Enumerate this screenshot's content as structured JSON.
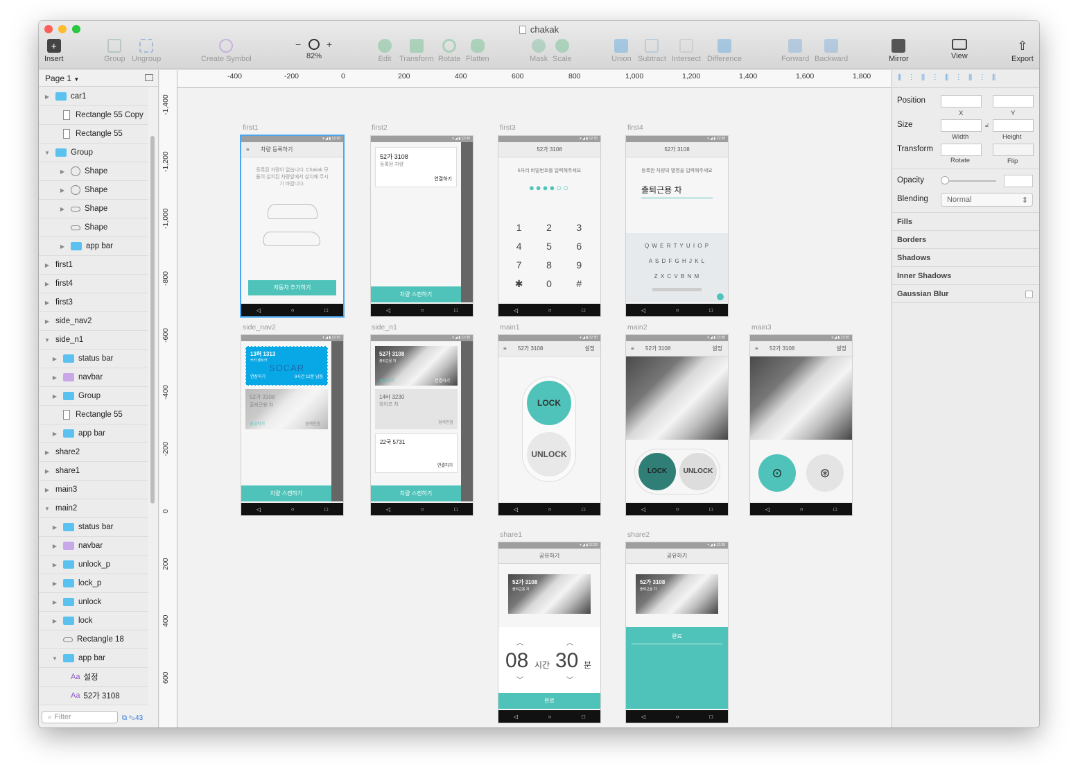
{
  "window": {
    "title": "chakak"
  },
  "toolbar": {
    "insert": "Insert",
    "group": "Group",
    "ungroup": "Ungroup",
    "create_symbol": "Create Symbol",
    "zoom_minus": "−",
    "zoom_plus": "+",
    "zoom": "82%",
    "edit": "Edit",
    "transform": "Transform",
    "rotate": "Rotate",
    "flatten": "Flatten",
    "mask": "Mask",
    "scale": "Scale",
    "union": "Union",
    "subtract": "Subtract",
    "intersect": "Intersect",
    "difference": "Difference",
    "forward": "Forward",
    "backward": "Backward",
    "mirror": "Mirror",
    "view": "View",
    "export": "Export"
  },
  "layers": {
    "page": "Page 1",
    "items": [
      {
        "label": "car1",
        "icon": "folder",
        "depth": 0,
        "tri": "▶"
      },
      {
        "label": "Rectangle 55 Copy",
        "icon": "rect",
        "depth": 1,
        "tri": ""
      },
      {
        "label": "Rectangle 55",
        "icon": "rect",
        "depth": 1,
        "tri": ""
      },
      {
        "label": "Group",
        "icon": "folder",
        "depth": 0,
        "tri": "▼"
      },
      {
        "label": "Shape",
        "icon": "oval",
        "depth": 2,
        "tri": "▶"
      },
      {
        "label": "Shape",
        "icon": "oval",
        "depth": 2,
        "tri": "▶"
      },
      {
        "label": "Shape",
        "icon": "pill",
        "depth": 2,
        "tri": "▶"
      },
      {
        "label": "Shape",
        "icon": "pill",
        "depth": 2,
        "tri": ""
      },
      {
        "label": "app bar",
        "icon": "folder",
        "depth": 2,
        "tri": "▶"
      },
      {
        "label": "first1",
        "icon": "",
        "depth": 0,
        "tri": "▶"
      },
      {
        "label": "first4",
        "icon": "",
        "depth": 0,
        "tri": "▶"
      },
      {
        "label": "first3",
        "icon": "",
        "depth": 0,
        "tri": "▶"
      },
      {
        "label": "side_nav2",
        "icon": "",
        "depth": 0,
        "tri": "▶"
      },
      {
        "label": "side_n1",
        "icon": "",
        "depth": 0,
        "tri": "▼"
      },
      {
        "label": "status bar",
        "icon": "folder",
        "depth": 1,
        "tri": "▶"
      },
      {
        "label": "navbar",
        "icon": "folderp",
        "depth": 1,
        "tri": "▶"
      },
      {
        "label": "Group",
        "icon": "folder",
        "depth": 1,
        "tri": "▶"
      },
      {
        "label": "Rectangle 55",
        "icon": "rect",
        "depth": 1,
        "tri": ""
      },
      {
        "label": "app bar",
        "icon": "folder",
        "depth": 1,
        "tri": "▶"
      },
      {
        "label": "share2",
        "icon": "",
        "depth": 0,
        "tri": "▶"
      },
      {
        "label": "share1",
        "icon": "",
        "depth": 0,
        "tri": "▶"
      },
      {
        "label": "main3",
        "icon": "",
        "depth": 0,
        "tri": "▶"
      },
      {
        "label": "main2",
        "icon": "",
        "depth": 0,
        "tri": "▼"
      },
      {
        "label": "status bar",
        "icon": "folder",
        "depth": 1,
        "tri": "▶"
      },
      {
        "label": "navbar",
        "icon": "folderp",
        "depth": 1,
        "tri": "▶"
      },
      {
        "label": "unlock_p",
        "icon": "folder",
        "depth": 1,
        "tri": "▶"
      },
      {
        "label": "lock_p",
        "icon": "folder",
        "depth": 1,
        "tri": "▶"
      },
      {
        "label": "unlock",
        "icon": "folder",
        "depth": 1,
        "tri": "▶"
      },
      {
        "label": "lock",
        "icon": "folder",
        "depth": 1,
        "tri": "▶"
      },
      {
        "label": "Rectangle 18",
        "icon": "pill",
        "depth": 1,
        "tri": ""
      },
      {
        "label": "app bar",
        "icon": "folder",
        "depth": 1,
        "tri": "▼"
      },
      {
        "label": "설정",
        "icon": "text",
        "depth": 2,
        "tri": ""
      },
      {
        "label": "52가 3108",
        "icon": "text",
        "depth": 2,
        "tri": ""
      }
    ],
    "filter_placeholder": "Filter",
    "count": "43"
  },
  "rulers": {
    "h": [
      "-400",
      "-200",
      "0",
      "200",
      "400",
      "600",
      "800",
      "1,000",
      "1,200",
      "1,400",
      "1,600",
      "1,800"
    ],
    "v": [
      "-1,400",
      "-1,200",
      "-1,000",
      "-800",
      "-600",
      "-400",
      "-200",
      "0",
      "200",
      "400",
      "600",
      "800"
    ]
  },
  "artboards": {
    "first1": {
      "name": "first1",
      "title": "차량 등록하기",
      "body": "등록된 차량이 없습니다. Chakak 모듈이 설치된 차량앞에서 설치해 주시기 바랍니다.",
      "button": "자동차 추가하기"
    },
    "first2": {
      "name": "first2",
      "car": "52가 3108",
      "sub": "등록된 차량",
      "connect": "연결하기",
      "button": "차량 스캔하기"
    },
    "first3": {
      "name": "first3",
      "title": "52가 3108",
      "prompt": "6자리 비밀번호를 입력해주세요",
      "keys": [
        "1",
        "2",
        "3",
        "4",
        "5",
        "6",
        "7",
        "8",
        "9",
        "✱",
        "0",
        "#"
      ]
    },
    "first4": {
      "name": "first4",
      "title": "52가 3108",
      "prompt": "등록한 차량의 별명을 입력해주세요",
      "value": "출퇴근용 차",
      "row1": "Q W E R T Y U I O P",
      "row2": "A S D F G H J K L",
      "row3": "Z X C V B N M"
    },
    "side_nav2": {
      "name": "side_nav2",
      "card": "13허 1313",
      "card_sub": "쏘카 렌트카",
      "brand": "SOCAR",
      "left": "연장하기",
      "right": "9시간 12분 남음",
      "car2": "52가 3108",
      "car2_sub": "출퇴근용 차",
      "share": "공유하기",
      "owner": "경색인함",
      "button": "차량 스캔하기"
    },
    "side_n1": {
      "name": "side_n1",
      "car1": "52가 3108",
      "car1_sub": "출퇴근용 차",
      "share": "공유하기",
      "connect": "연결하기",
      "car2": "14바 3230",
      "car2_sub": "와이프 차",
      "owner": "경색인함",
      "car3": "22국 5731",
      "connect2": "연결하기",
      "button": "차량 스캔하기"
    },
    "main1": {
      "name": "main1",
      "title": "52가 3108",
      "settings": "설정",
      "lock": "LOCK",
      "unlock": "UNLOCK"
    },
    "main2": {
      "name": "main2",
      "title": "52가 3108",
      "settings": "설정",
      "lock": "LOCK",
      "unlock": "UNLOCK"
    },
    "main3": {
      "name": "main3",
      "title": "52가 3108",
      "settings": "설정"
    },
    "share1": {
      "name": "share1",
      "title": "공유하기",
      "car": "52가 3108",
      "car_sub": "출퇴근용 차",
      "hours": "08",
      "hours_unit": "시간",
      "minutes": "30",
      "minutes_unit": "분",
      "button": "완료"
    },
    "share2": {
      "name": "share2",
      "title": "공유하기",
      "car": "52가 3108",
      "car_sub": "출퇴근용 차",
      "button": "완료"
    }
  },
  "inspector": {
    "position": "Position",
    "x": "X",
    "y": "Y",
    "size": "Size",
    "width": "Width",
    "height": "Height",
    "transform": "Transform",
    "rotate": "Rotate",
    "flip": "Flip",
    "opacity": "Opacity",
    "blending": "Blending",
    "blending_value": "Normal",
    "sections": [
      "Fills",
      "Borders",
      "Shadows",
      "Inner Shadows",
      "Gaussian Blur"
    ]
  },
  "colors": {
    "accent": "#4fc3b9",
    "selection": "#4aa7ef",
    "folder": "#5bc1ef",
    "symbol": "#c9a8ea"
  }
}
